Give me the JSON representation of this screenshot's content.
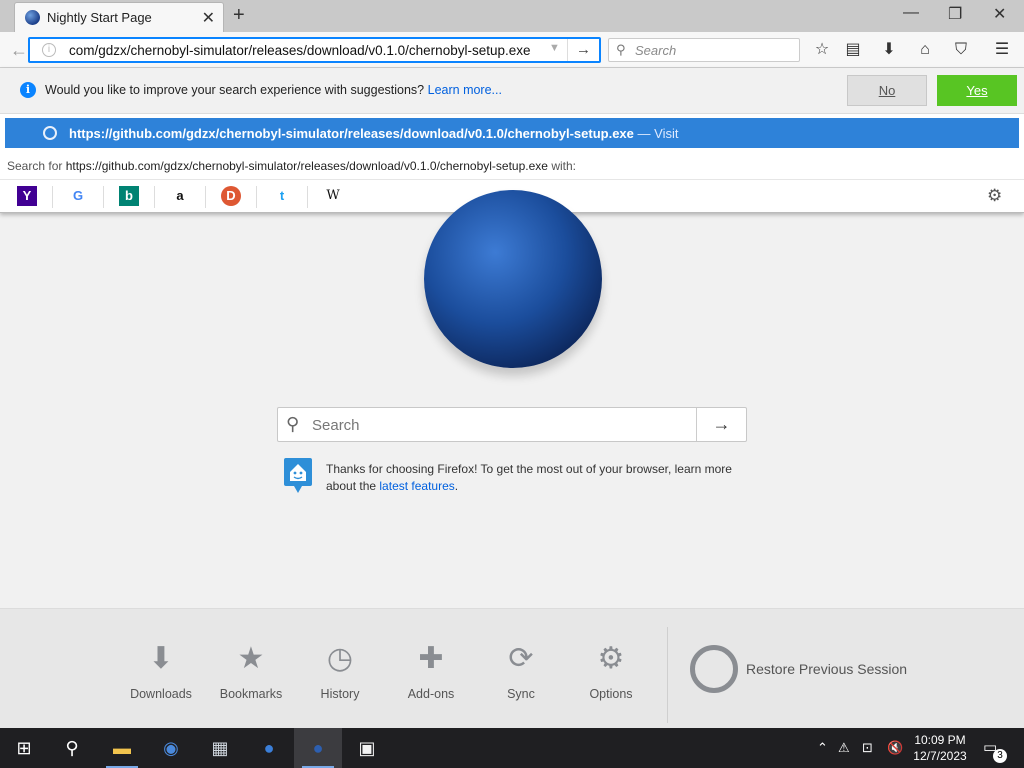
{
  "tab": {
    "title": "Nightly Start Page"
  },
  "nav": {
    "url": "com/gdzx/chernobyl-simulator/releases/download/v0.1.0/chernobyl-setup.exe",
    "search_placeholder": "Search"
  },
  "notification": {
    "message": "Would you like to improve your search experience with suggestions?",
    "learn_more": "Learn more...",
    "no_label": "No",
    "yes_label": "Yes"
  },
  "suggestion": {
    "url": "https://github.com/gdzx/chernobyl-simulator/releases/download/v0.1.0/chernobyl-setup.exe",
    "visit": "— Visit"
  },
  "search_for": {
    "prefix": "Search for",
    "query": "https://github.com/gdzx/chernobyl-simulator/releases/download/v0.1.0/chernobyl-setup.exe",
    "suffix": "with:"
  },
  "engines": [
    {
      "name": "yahoo-icon",
      "glyph": "Y"
    },
    {
      "name": "google-icon",
      "glyph": "G"
    },
    {
      "name": "bing-icon",
      "glyph": "b"
    },
    {
      "name": "amazon-icon",
      "glyph": "a"
    },
    {
      "name": "duckduckgo-icon",
      "glyph": "D"
    },
    {
      "name": "twitter-icon",
      "glyph": "t"
    },
    {
      "name": "wikipedia-icon",
      "glyph": "W"
    }
  ],
  "main_search": {
    "placeholder": "Search"
  },
  "snippet": {
    "text": "Thanks for choosing Firefox! To get the most out of your browser, learn more about the",
    "link": "latest features",
    "end": "."
  },
  "launcher": {
    "downloads": "Downloads",
    "bookmarks": "Bookmarks",
    "history": "History",
    "addons": "Add-ons",
    "sync": "Sync",
    "options": "Options",
    "restore": "Restore Previous Session"
  },
  "taskbar": {
    "time": "10:09 PM",
    "date": "12/7/2023",
    "notifications": "3"
  },
  "colors": {
    "accent": "#0a84ff",
    "suggestion_bg": "#2e82d9",
    "yes_green": "#58c523"
  }
}
